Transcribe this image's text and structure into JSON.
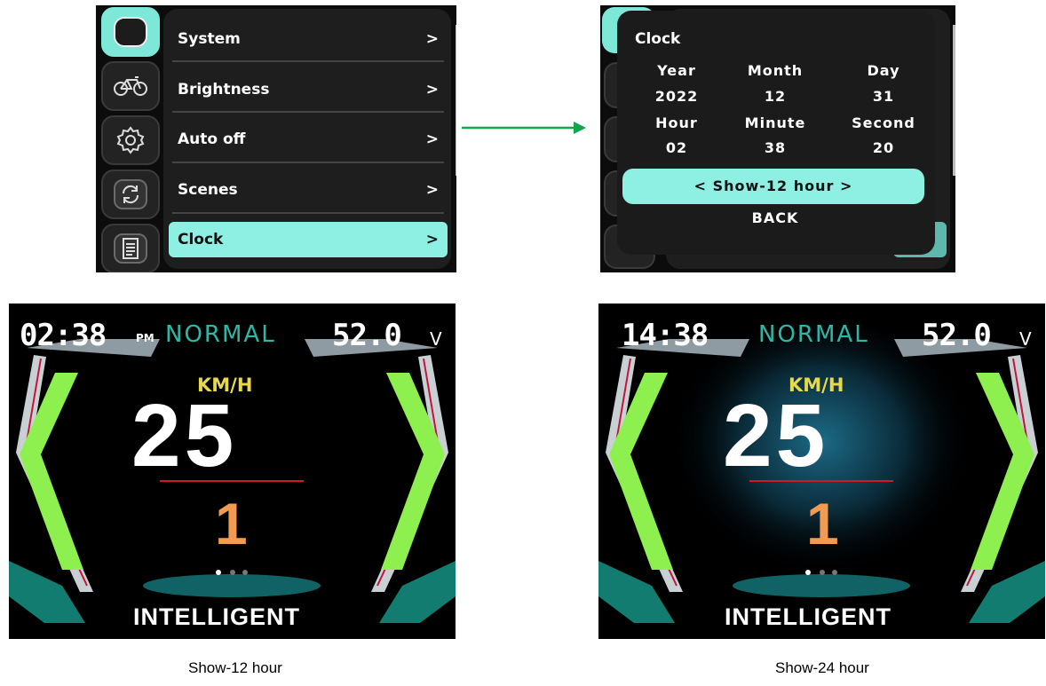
{
  "settings_menu": {
    "items": [
      {
        "label": "System",
        "arrow": ">"
      },
      {
        "label": "Brightness",
        "arrow": ">"
      },
      {
        "label": "Auto off",
        "arrow": ">"
      },
      {
        "label": "Scenes",
        "arrow": ">"
      },
      {
        "label": "Clock",
        "arrow": ">"
      }
    ],
    "selected": "Clock",
    "side_icons": [
      "phone-icon",
      "bicycle-icon",
      "gear-icon",
      "refresh-icon",
      "document-icon"
    ],
    "accent_color": "#8ef0e2"
  },
  "clock_dialog": {
    "title": "Clock",
    "labels": {
      "year": "Year",
      "month": "Month",
      "day": "Day",
      "hour": "Hour",
      "minute": "Minute",
      "second": "Second"
    },
    "values": {
      "year": "2022",
      "month": "12",
      "day": "31",
      "hour": "02",
      "minute": "38",
      "second": "20"
    },
    "selected_option": "< Show-12 hour >",
    "back_label": "BACK"
  },
  "dashboards": [
    {
      "time": "02:38",
      "ampm": "PM",
      "mode": "NORMAL",
      "voltage": "52.0",
      "voltage_unit": "V",
      "units": "KM/H",
      "speed": "25",
      "gear": "1",
      "assist_mode": "INTELLIGENT",
      "caption": "Show-12 hour"
    },
    {
      "time": "14:38",
      "ampm": "",
      "mode": "NORMAL",
      "voltage": "52.0",
      "voltage_unit": "V",
      "units": "KM/H",
      "speed": "25",
      "gear": "1",
      "assist_mode": "INTELLIGENT",
      "caption": "Show-24 hour"
    }
  ],
  "colors": {
    "arrow": "#12a64e",
    "chevron": "#8ef04f",
    "speed_units": "#e8d94a",
    "gear": "#f29a50",
    "mode": "#2fb7a6"
  }
}
